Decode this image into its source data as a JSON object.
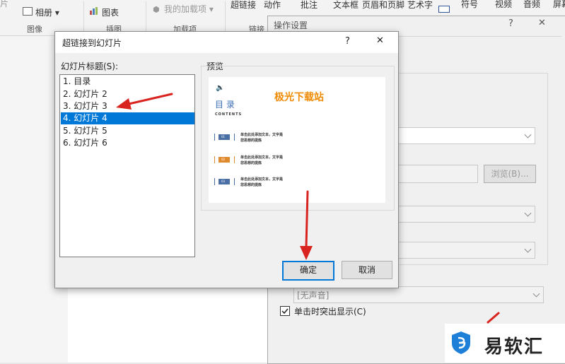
{
  "ribbon": {
    "items": [
      {
        "label": "相册"
      },
      {
        "label": "图表"
      },
      {
        "label": "我的加载项"
      },
      {
        "label": "超链接"
      },
      {
        "label": "动作"
      },
      {
        "label": "批注"
      },
      {
        "label": "文本框"
      },
      {
        "label": "页眉和页脚"
      },
      {
        "label": "艺术字"
      },
      {
        "label": "符号"
      },
      {
        "label": "视频"
      },
      {
        "label": "音频"
      },
      {
        "label": "屏幕"
      }
    ],
    "groups": {
      "image": "图像",
      "illustrations": "插图",
      "addins": "加载项",
      "links": "链接"
    }
  },
  "action_dialog": {
    "title": "操作设置",
    "help": "?",
    "close": "✕",
    "browse_label": "浏览(B)...",
    "sound_value": "[无声音]",
    "highlight_label": "单击时突出显示(C)",
    "highlight_checked": true
  },
  "link_dialog": {
    "title": "超链接到幻灯片",
    "help": "?",
    "close": "✕",
    "list_label": "幻灯片标题(S):",
    "preview_label": "预览",
    "slides": [
      "1. 目录",
      "2. 幻灯片 2",
      "3. 幻灯片 3",
      "4. 幻灯片 4",
      "5. 幻灯片 5",
      "6. 幻灯片 6"
    ],
    "selected_index": 3,
    "ok_label": "确定",
    "cancel_label": "取消"
  },
  "preview_slide": {
    "title": "目 录",
    "subtitle": "CONTENTS",
    "overlay_text": "极光下载站",
    "rows": [
      {
        "num": "01",
        "line1": "单击此处添加文本，文字是",
        "line2": "您思想的提炼",
        "color": "#4a6fa5"
      },
      {
        "num": "02",
        "line1": "单击此处添加文本，文字是",
        "line2": "您思想的提炼",
        "color": "#e08a2e"
      },
      {
        "num": "03",
        "line1": "单击此处添加文本，文字是",
        "line2": "您思想的提炼",
        "color": "#4a6fa5"
      }
    ]
  },
  "watermark": {
    "text": "易软汇"
  },
  "colors": {
    "selection": "#0078d7",
    "annotation_arrow": "#d9231e",
    "ok_border": "#0078d7"
  }
}
